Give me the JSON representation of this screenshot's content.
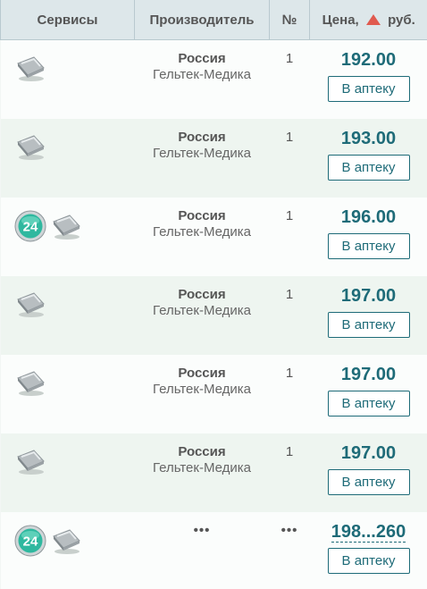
{
  "header": {
    "services": "Сервисы",
    "manufacturer": "Производитель",
    "number": "№",
    "price_prefix": "Цена,",
    "price_suffix": "руб."
  },
  "rows": [
    {
      "has24": false,
      "country": "Россия",
      "maker": "Гельтек-Медика",
      "num": "1",
      "price": "192.00",
      "button": "В аптеку"
    },
    {
      "has24": false,
      "country": "Россия",
      "maker": "Гельтек-Медика",
      "num": "1",
      "price": "193.00",
      "button": "В аптеку"
    },
    {
      "has24": true,
      "country": "Россия",
      "maker": "Гельтек-Медика",
      "num": "1",
      "price": "196.00",
      "button": "В аптеку"
    },
    {
      "has24": false,
      "country": "Россия",
      "maker": "Гельтек-Медика",
      "num": "1",
      "price": "197.00",
      "button": "В аптеку"
    },
    {
      "has24": false,
      "country": "Россия",
      "maker": "Гельтек-Медика",
      "num": "1",
      "price": "197.00",
      "button": "В аптеку"
    },
    {
      "has24": false,
      "country": "Россия",
      "maker": "Гельтек-Медика",
      "num": "1",
      "price": "197.00",
      "button": "В аптеку"
    }
  ],
  "summary": {
    "has24": true,
    "maker_dots": "•••",
    "num_dots": "•••",
    "price_range": "198...260",
    "button": "В аптеку"
  },
  "badge_24_label": "24",
  "icons": {
    "service": "pill-pack-icon",
    "round_the_clock": "24-hours-badge-icon",
    "sort": "sort-ascending-triangle-icon"
  },
  "colors": {
    "price": "#1e6b78",
    "sort_arrow": "#e05a4f",
    "header_bg": "#dde7ea",
    "badge": "#2fb89f"
  }
}
